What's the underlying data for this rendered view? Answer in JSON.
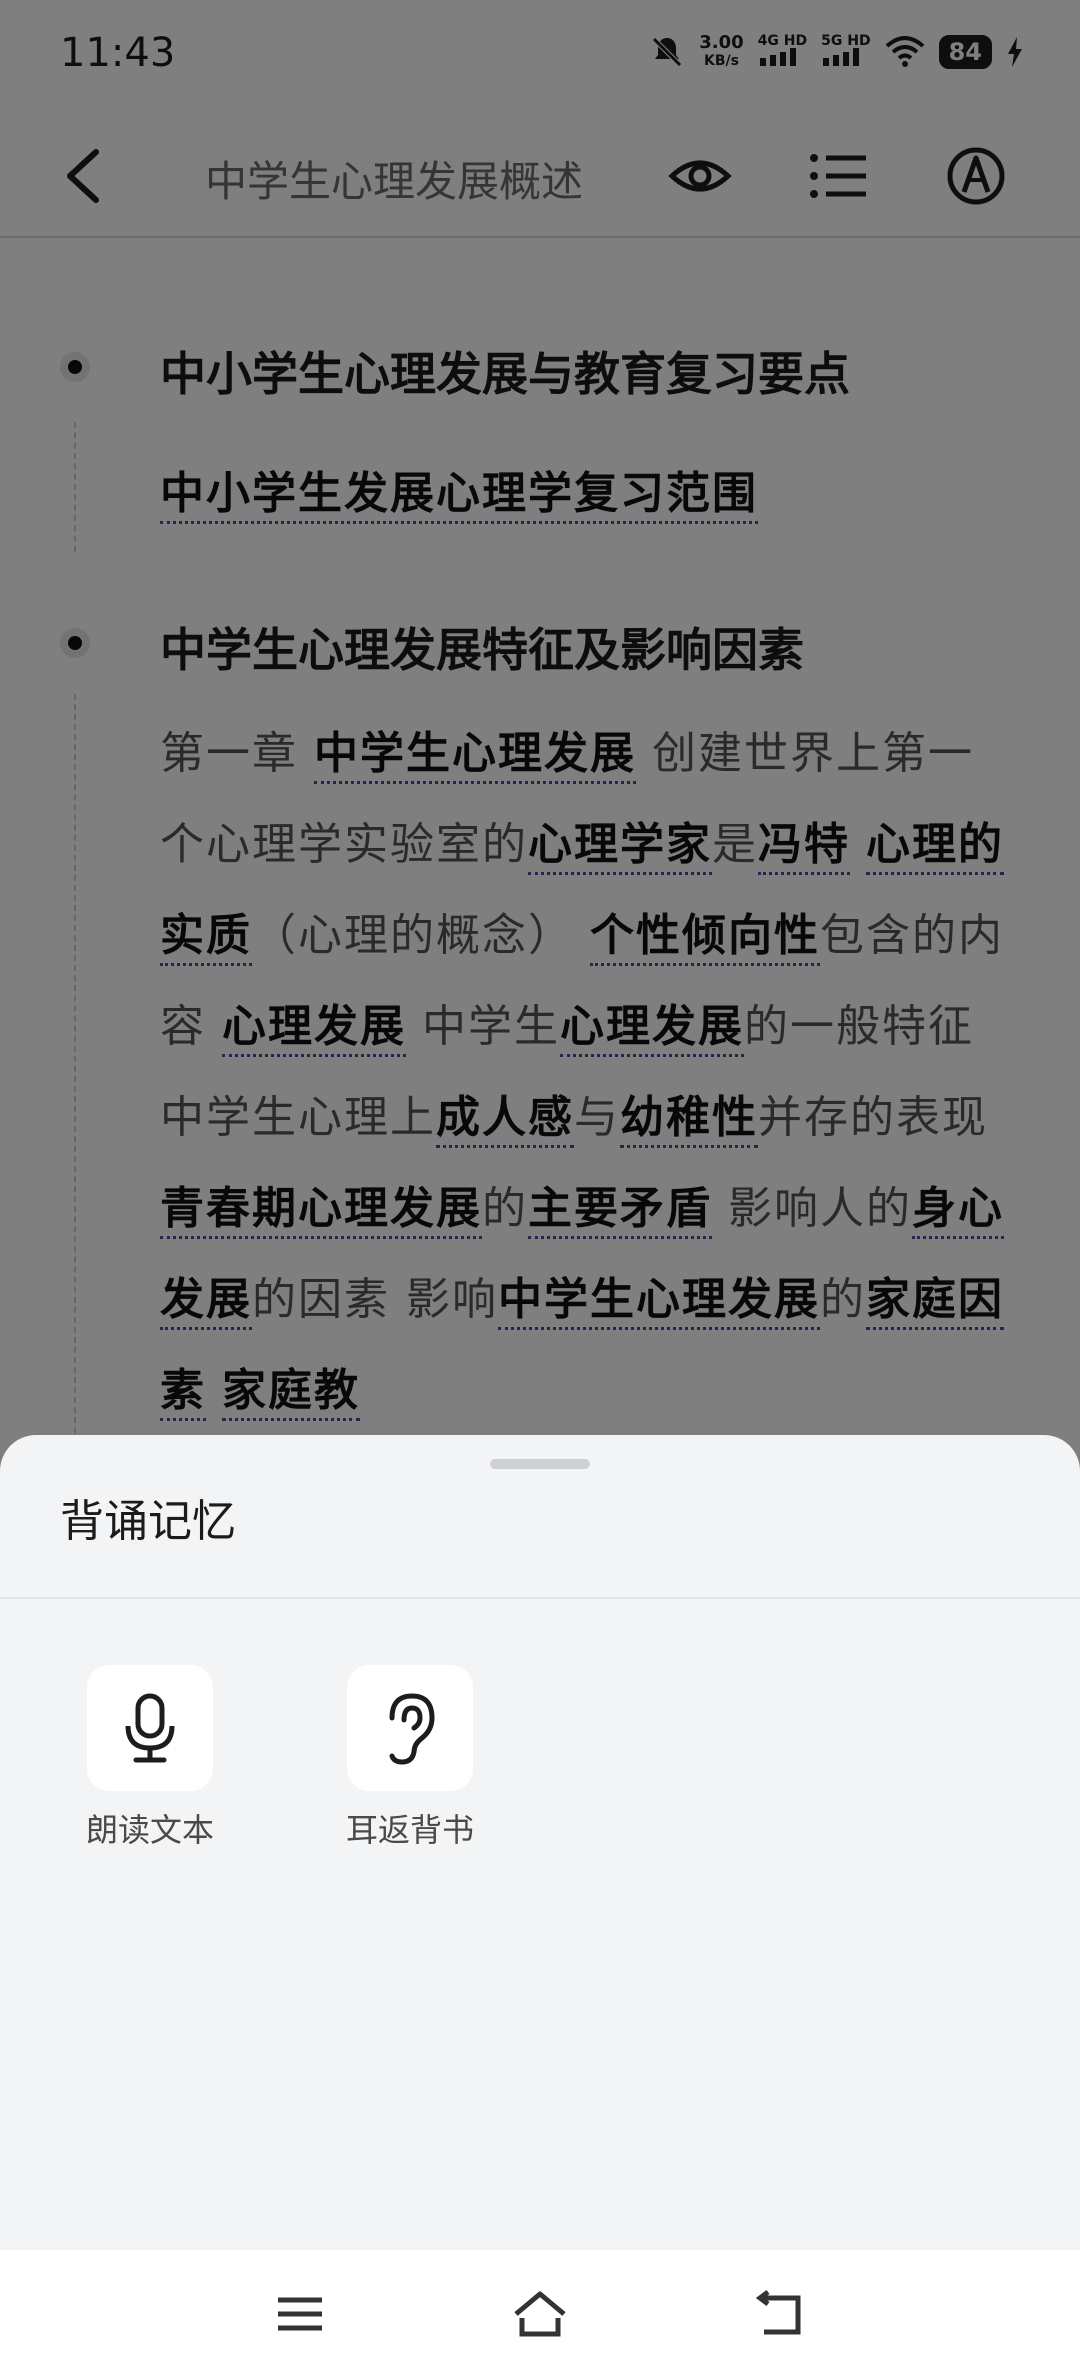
{
  "status_bar": {
    "time": "11:43",
    "speed_value": "3.00",
    "speed_unit": "KB/s",
    "net1": "4G HD",
    "net2": "5G HD",
    "battery": "84"
  },
  "header": {
    "title": "中学生心理发展概述"
  },
  "sections": [
    {
      "title": "中小学生心理发展与教育复习要点",
      "link": "中小学生发展心理学复习范围"
    },
    {
      "title": "中学生心理发展特征及影响因素",
      "segments": [
        {
          "t": "第一章 ",
          "k": false
        },
        {
          "t": "中学生心理发展",
          "k": true
        },
        {
          "t": " 创建世界上第一个心理学实验室的",
          "k": false
        },
        {
          "t": "心理学家",
          "k": true
        },
        {
          "t": "是",
          "k": false
        },
        {
          "t": "冯特",
          "k": true
        },
        {
          "t": " ",
          "k": false
        },
        {
          "t": "心理的实质",
          "k": true
        },
        {
          "t": "（心理的概念） ",
          "k": false
        },
        {
          "t": "个性倾向性",
          "k": true
        },
        {
          "t": "包含的内容 ",
          "k": false
        },
        {
          "t": "心理发展",
          "k": true
        },
        {
          "t": " 中学生",
          "k": false
        },
        {
          "t": "心理发展",
          "k": true
        },
        {
          "t": "的一般特征 中学生心理上",
          "k": false
        },
        {
          "t": "成人感",
          "k": true
        },
        {
          "t": "与",
          "k": false
        },
        {
          "t": "幼稚性",
          "k": true
        },
        {
          "t": "并存的表现 ",
          "k": false
        },
        {
          "t": "青春期心理发展",
          "k": true
        },
        {
          "t": "的",
          "k": false
        },
        {
          "t": "主要矛盾",
          "k": true
        },
        {
          "t": " 影响人的",
          "k": false
        },
        {
          "t": "身心发展",
          "k": true
        },
        {
          "t": "的因素 影响",
          "k": false
        },
        {
          "t": "中学生心理发展",
          "k": true
        },
        {
          "t": "的",
          "k": false
        },
        {
          "t": "家庭因素",
          "k": true
        },
        {
          "t": " ",
          "k": false
        },
        {
          "t": "家庭教",
          "k": true
        }
      ]
    }
  ],
  "sheet": {
    "title": "背诵记忆",
    "options": [
      {
        "label": "朗读文本",
        "icon": "microphone-icon"
      },
      {
        "label": "耳返背书",
        "icon": "ear-icon"
      }
    ]
  },
  "nav": {
    "icons": [
      "menu-icon",
      "home-icon",
      "back-icon"
    ]
  }
}
